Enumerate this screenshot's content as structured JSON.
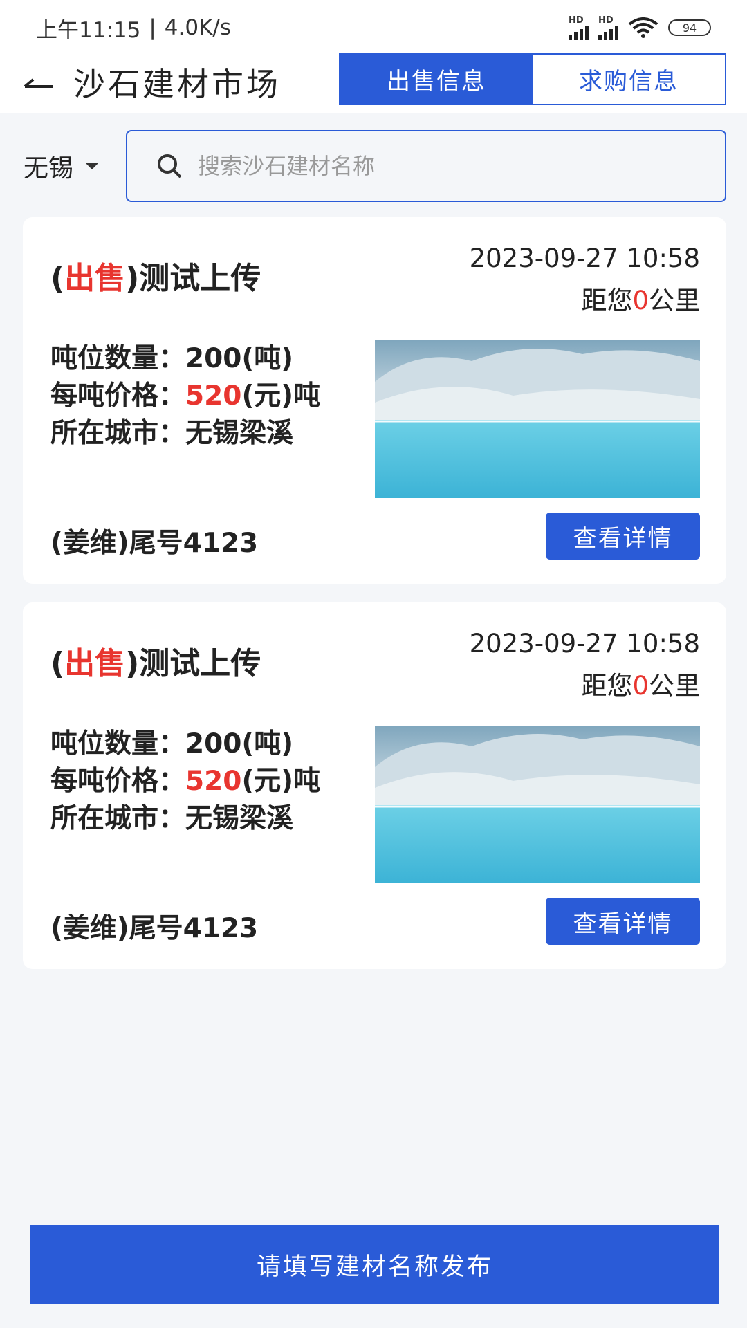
{
  "status_bar": {
    "time": "上午11:15",
    "separator": "|",
    "speed": "4.0K/s",
    "signal_label": "HD",
    "battery": "94"
  },
  "header": {
    "back_icon": "back-arrow-icon",
    "title": "沙石建材市场",
    "tabs": [
      {
        "label": "出售信息",
        "active": true
      },
      {
        "label": "求购信息",
        "active": false
      }
    ]
  },
  "search": {
    "city": "无锡",
    "placeholder": "搜索沙石建材名称",
    "value": ""
  },
  "listings": [
    {
      "type_open": "(",
      "type": "出售",
      "type_close": ")",
      "name": "测试上传",
      "time": "2023-09-27 10:58",
      "dist_prefix": "距您",
      "distance": "0",
      "dist_suffix": "公里",
      "qty_label": "吨位数量：",
      "qty_value": "200(吨)",
      "price_label": "每吨价格：",
      "price_value": "520",
      "price_unit": "(元)吨",
      "city_label": "所在城市：",
      "city_value": "无锡梁溪",
      "owner": "(姜维)尾号4123",
      "detail_label": "查看详情"
    },
    {
      "type_open": "(",
      "type": "出售",
      "type_close": ")",
      "name": "测试上传",
      "time": "2023-09-27 10:58",
      "dist_prefix": "距您",
      "distance": "0",
      "dist_suffix": "公里",
      "qty_label": "吨位数量：",
      "qty_value": "200(吨)",
      "price_label": "每吨价格：",
      "price_value": "520",
      "price_unit": "(元)吨",
      "city_label": "所在城市：",
      "city_value": "无锡梁溪",
      "owner": "(姜维)尾号4123",
      "detail_label": "查看详情"
    }
  ],
  "publish_label": "请填写建材名称发布",
  "colors": {
    "primary": "#2a5bd7",
    "highlight": "#e8352f",
    "background": "#f4f6f9"
  }
}
